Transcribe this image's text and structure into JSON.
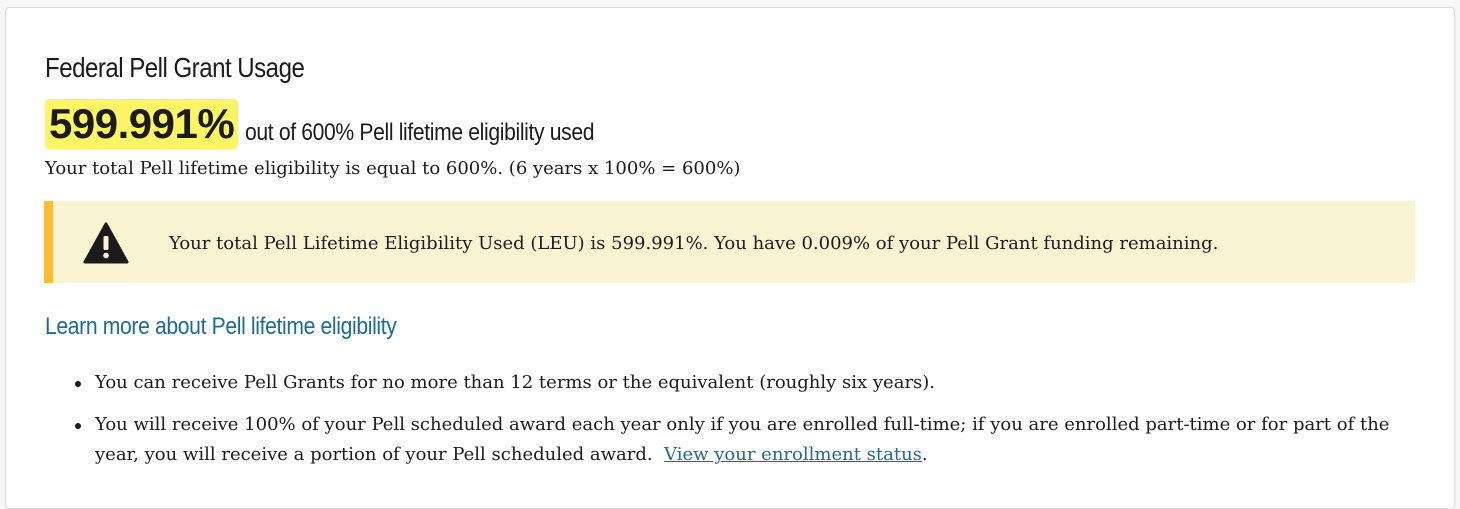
{
  "section": {
    "title": "Federal Pell Grant Usage",
    "usage_value": "599.991%",
    "usage_suffix": "out of 600% Pell lifetime eligibility used",
    "total_eligibility": "Your total Pell lifetime eligibility is equal to 600%. (6 years x 100% = 600%)"
  },
  "alert": {
    "icon": "warning-icon",
    "message": "Your total Pell Lifetime Eligibility Used (LEU) is 599.991%. You have 0.009% of your Pell Grant funding remaining.",
    "background": "#faf3d1",
    "accent": "#ffbe2e"
  },
  "learn_more": {
    "label": "Learn more about Pell lifetime eligibility"
  },
  "bullets": [
    {
      "text": "You can receive Pell Grants for no more than 12 terms or the equivalent (roughly six years)."
    },
    {
      "text": "You will receive 100% of your Pell scheduled award each year only if you are enrolled full-time; if you are enrolled part-time or for part of the year, you will receive a portion of your Pell scheduled award.",
      "link_label": "View your enrollment status",
      "trailing": "."
    }
  ],
  "colors": {
    "highlight": "#fdf565",
    "link": "#1a6c94",
    "text": "#1b1b1b"
  }
}
